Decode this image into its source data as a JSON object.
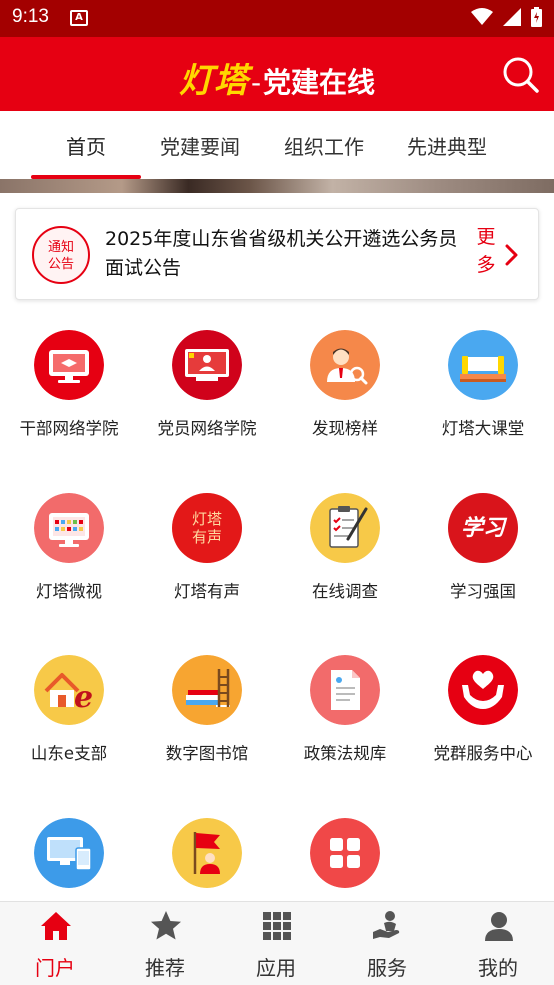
{
  "status_bar": {
    "time": "9:13",
    "notification_glyph": "A"
  },
  "app_bar": {
    "logo_text": "灯塔",
    "separator": "-",
    "subtitle": "党建在线",
    "search_icon": "search-icon"
  },
  "tabs": [
    {
      "label": "首页",
      "active": true
    },
    {
      "label": "党建要闻",
      "active": false
    },
    {
      "label": "组织工作",
      "active": false
    },
    {
      "label": "先进典型",
      "active": false
    }
  ],
  "notice": {
    "badge_line1": "通知",
    "badge_line2": "公告",
    "text": "2025年度山东省省级机关公开遴选公务员面试公告",
    "more_line1": "更",
    "more_line2": "多"
  },
  "grid": [
    {
      "label": "干部网络学院",
      "icon": "cadre-academy-icon",
      "color": "#e60012"
    },
    {
      "label": "党员网络学院",
      "icon": "party-member-academy-icon",
      "color": "#d0021b"
    },
    {
      "label": "发现榜样",
      "icon": "find-role-model-icon",
      "color": "#f5884a"
    },
    {
      "label": "灯塔大课堂",
      "icon": "lecture-hall-icon",
      "color": "#4aa8f0"
    },
    {
      "label": "灯塔微视",
      "icon": "micro-video-icon",
      "color": "#f26b6b"
    },
    {
      "label": "灯塔有声",
      "icon": "audio-icon",
      "color": "#e31818",
      "icon_text_1": "灯塔",
      "icon_text_2": "有声"
    },
    {
      "label": "在线调查",
      "icon": "online-survey-icon",
      "color": "#f7c948"
    },
    {
      "label": "学习强国",
      "icon": "xuexi-qiangguo-icon",
      "color": "#d9141b",
      "icon_text": "学习"
    },
    {
      "label": "山东e支部",
      "icon": "shandong-e-branch-icon",
      "color": "#f7c948"
    },
    {
      "label": "数字图书馆",
      "icon": "digital-library-icon",
      "color": "#f7a531"
    },
    {
      "label": "政策法规库",
      "icon": "policy-library-icon",
      "color": "#f26b6b"
    },
    {
      "label": "党群服务中心",
      "icon": "service-center-icon",
      "color": "#e60012"
    },
    {
      "label": "",
      "icon": "computer-icon",
      "color": "#3d9be9"
    },
    {
      "label": "",
      "icon": "flag-person-icon",
      "color": "#f7c948"
    },
    {
      "label": "",
      "icon": "more-apps-icon",
      "color": "#f04848"
    }
  ],
  "bottom_nav": [
    {
      "label": "门户",
      "icon": "home-icon",
      "active": true
    },
    {
      "label": "推荐",
      "icon": "star-icon",
      "active": false
    },
    {
      "label": "应用",
      "icon": "apps-grid-icon",
      "active": false
    },
    {
      "label": "服务",
      "icon": "service-hand-icon",
      "active": false
    },
    {
      "label": "我的",
      "icon": "user-icon",
      "active": false
    }
  ],
  "colors": {
    "primary": "#e60012",
    "status_bar": "#a30000",
    "logo": "#ffd700"
  }
}
